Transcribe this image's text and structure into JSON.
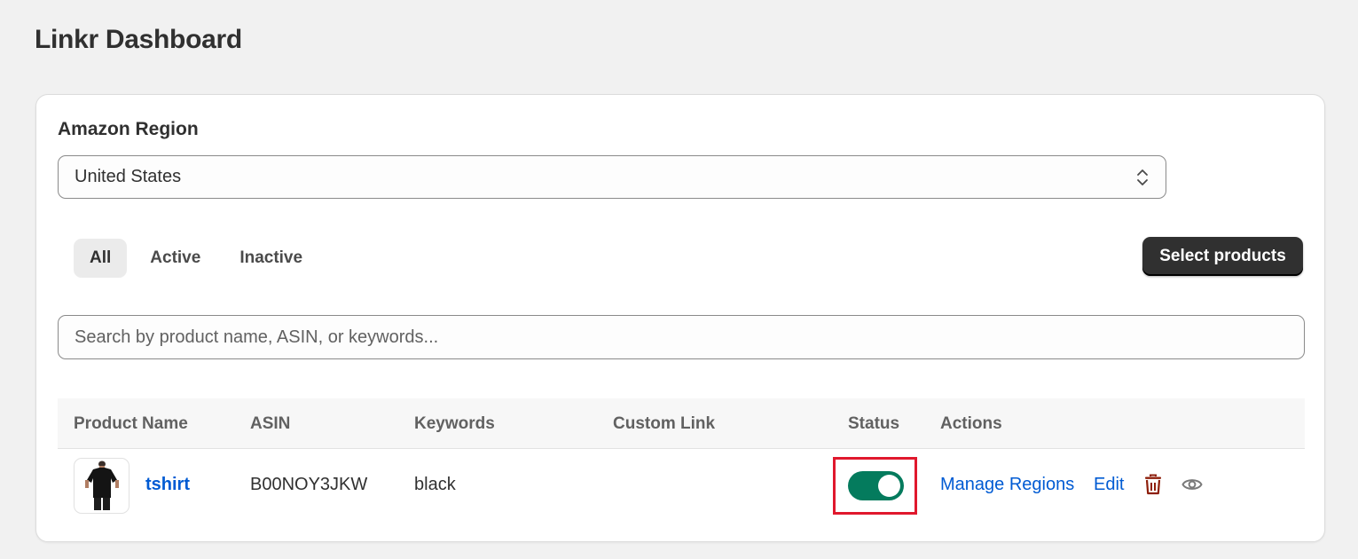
{
  "page": {
    "title": "Linkr Dashboard"
  },
  "region": {
    "label": "Amazon Region",
    "selected": "United States"
  },
  "tabs": [
    {
      "label": "All",
      "selected": true
    },
    {
      "label": "Active",
      "selected": false
    },
    {
      "label": "Inactive",
      "selected": false
    }
  ],
  "toolbar": {
    "select_products_label": "Select products"
  },
  "search": {
    "placeholder": "Search by product name, ASIN, or keywords..."
  },
  "table": {
    "columns": [
      "Product Name",
      "ASIN",
      "Keywords",
      "Custom Link",
      "Status",
      "Actions"
    ],
    "rows": [
      {
        "product_name": "tshirt",
        "asin": "B00NOY3JKW",
        "keywords": "black",
        "custom_link": "",
        "status_on": true,
        "actions": {
          "manage_regions": "Manage Regions",
          "edit": "Edit",
          "delete_icon": "trash-icon",
          "view_icon": "eye-icon"
        }
      }
    ]
  },
  "colors": {
    "accent_link": "#005bd3",
    "toggle_on": "#047b5d",
    "delete": "#8e1f0b",
    "highlight_box": "#e0182d"
  }
}
